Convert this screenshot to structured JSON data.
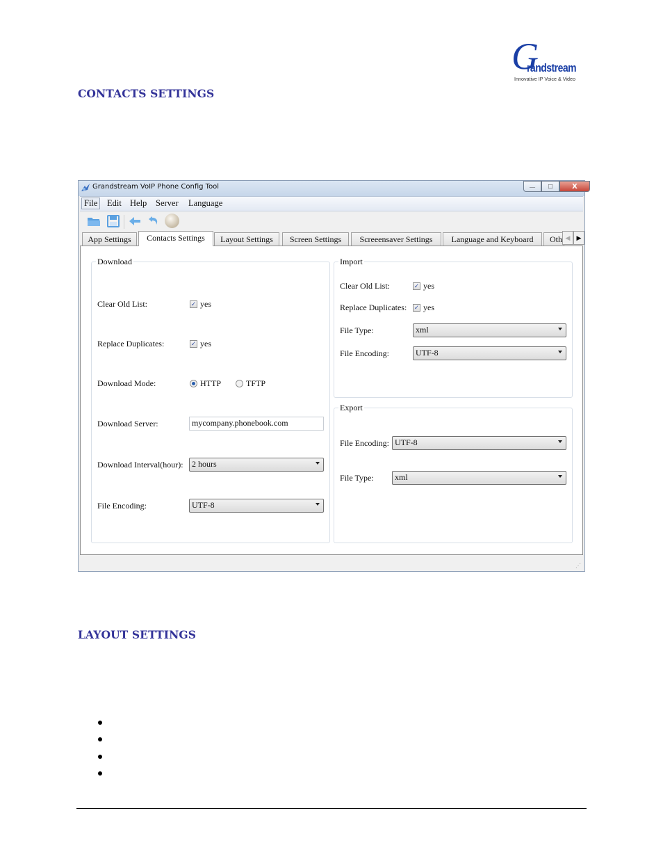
{
  "logo": {
    "letter": "G",
    "word": "randstream",
    "tagline": "Innovative IP Voice & Video"
  },
  "headings": {
    "contacts": "CONTACTS SETTINGS",
    "layout": "LAYOUT SETTINGS"
  },
  "window": {
    "title": "Grandstream VoIP Phone Config Tool",
    "controls": {
      "minimize": "—",
      "maximize": "□",
      "close": "X"
    },
    "menu": [
      "File",
      "Edit",
      "Help",
      "Server",
      "Language"
    ],
    "toolbar_icons": [
      "open-folder-icon",
      "save-icon",
      "back-arrow-icon",
      "undo-icon",
      "sphere-icon"
    ],
    "tabs": [
      "App Settings",
      "Contacts Settings",
      "Layout Settings",
      "Screen Settings",
      "Screeensaver Settings",
      "Language and Keyboard",
      "Oth"
    ],
    "selected_tab": "Contacts Settings",
    "tab_arrows": {
      "left": "◀",
      "right": "▶"
    }
  },
  "download": {
    "title": "Download",
    "clear_old_list": {
      "label": "Clear Old List:",
      "checked": true,
      "text": "yes"
    },
    "replace_duplicates": {
      "label": "Replace Duplicates:",
      "checked": true,
      "text": "yes"
    },
    "download_mode": {
      "label": "Download Mode:",
      "options": [
        "HTTP",
        "TFTP"
      ],
      "selected": "HTTP"
    },
    "download_server": {
      "label": "Download Server:",
      "value": "mycompany.phonebook.com"
    },
    "download_interval": {
      "label": "Download Interval(hour):",
      "value": "2 hours"
    },
    "file_encoding": {
      "label": "File Encoding:",
      "value": "UTF-8"
    }
  },
  "import": {
    "title": "Import",
    "clear_old_list": {
      "label": "Clear Old List:",
      "checked": true,
      "text": "yes"
    },
    "replace_duplicates": {
      "label": "Replace Duplicates:",
      "checked": true,
      "text": "yes"
    },
    "file_type": {
      "label": "File Type:",
      "value": "xml"
    },
    "file_encoding": {
      "label": "File Encoding:",
      "value": "UTF-8"
    }
  },
  "export": {
    "title": "Export",
    "file_encoding": {
      "label": "File Encoding:",
      "value": "UTF-8"
    },
    "file_type": {
      "label": "File Type:",
      "value": "xml"
    }
  },
  "check_glyph": "✓",
  "bullets_count": 4
}
